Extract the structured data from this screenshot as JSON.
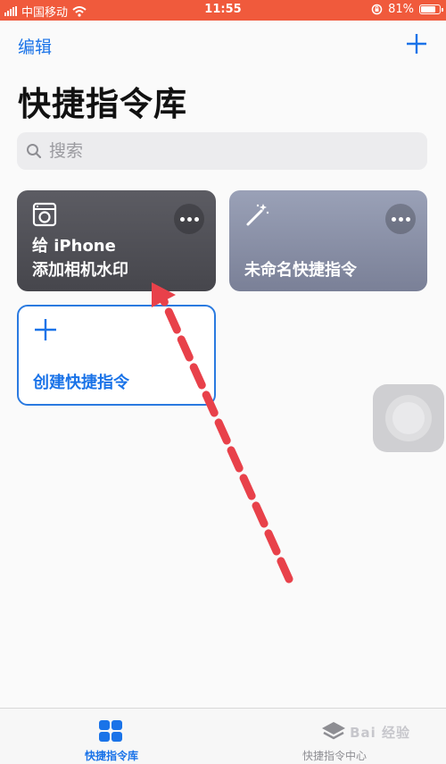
{
  "status_bar": {
    "carrier": "中国移动",
    "time": "11:55",
    "battery": "81%",
    "battery_level": 0.81,
    "icons": [
      "signal-icon",
      "wifi-icon",
      "lock-rotation-icon",
      "battery-icon"
    ]
  },
  "nav": {
    "edit_label": "编辑",
    "add_icon": "plus-icon"
  },
  "page_title": "快捷指令库",
  "search": {
    "placeholder": "搜索",
    "value": ""
  },
  "shortcuts": [
    {
      "title_line1": "给 iPhone",
      "title_line2": "添加相机水印",
      "icon": "washing-machine-icon",
      "color": "#505057"
    },
    {
      "title": "未命名快捷指令",
      "icon": "magic-wand-icon",
      "color": "#8a90a7"
    }
  ],
  "create_card": {
    "label": "创建快捷指令",
    "icon": "plus-icon",
    "accent": "#1a73e8"
  },
  "tabs": [
    {
      "label": "快捷指令库",
      "icon": "grid-icon",
      "active": true
    },
    {
      "label": "快捷指令中心",
      "icon": "layers-icon",
      "active": false
    }
  ],
  "watermark": "Bai 经验",
  "colors": {
    "status_bar": "#f05a3c",
    "accent": "#1a73e8",
    "arrow": "#e8414a"
  }
}
